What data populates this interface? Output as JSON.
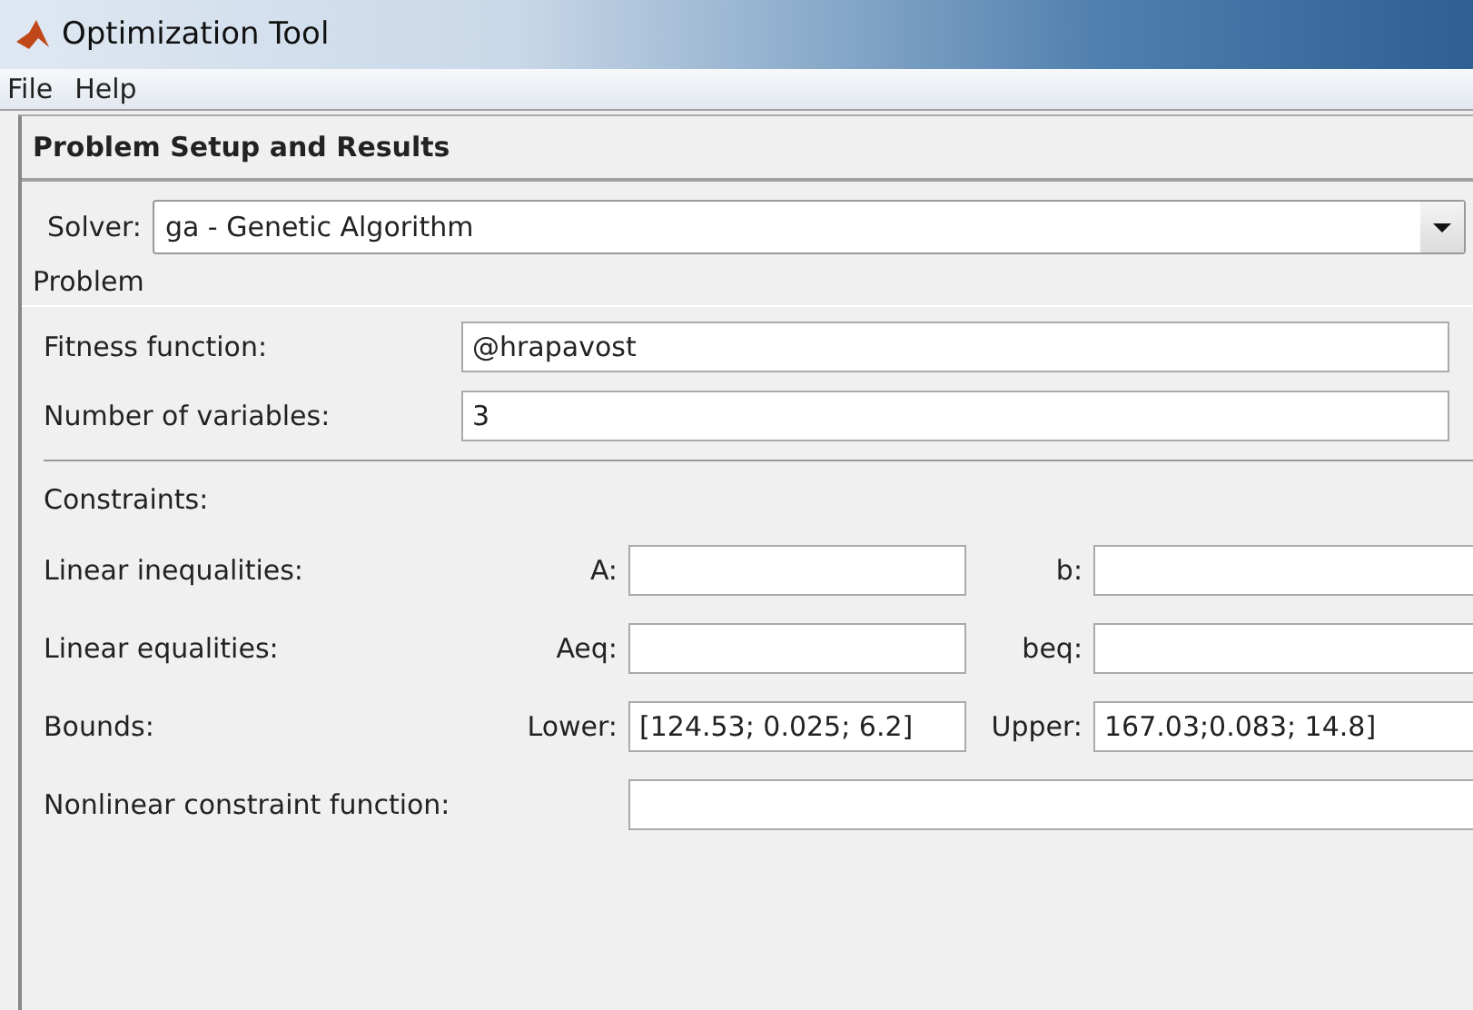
{
  "window": {
    "title": "Optimization Tool"
  },
  "menu": [
    "File",
    "Help"
  ],
  "panel": {
    "title": "Problem Setup and Results"
  },
  "solver": {
    "label": "Solver:",
    "value": "ga - Genetic Algorithm"
  },
  "problem": {
    "title": "Problem",
    "fields": [
      {
        "label": "Fitness function:",
        "value": "@hrapavost"
      },
      {
        "label": "Number of variables:",
        "value": "3"
      }
    ]
  },
  "constraints": {
    "title": "Constraints:",
    "rows": [
      {
        "kind": "pair",
        "label": "Linear inequalities:",
        "left_label": "A:",
        "left_value": "",
        "right_label": "b:",
        "right_value": ""
      },
      {
        "kind": "pair",
        "label": "Linear equalities:",
        "left_label": "Aeq:",
        "left_value": "",
        "right_label": "beq:",
        "right_value": ""
      },
      {
        "kind": "pair",
        "label": "Bounds:",
        "left_label": "Lower:",
        "left_value": "[124.53; 0.025; 6.2]",
        "right_label": "Upper:",
        "right_value": "167.03;0.083; 14.8]"
      },
      {
        "kind": "single",
        "label": "Nonlinear constraint function:",
        "value": ""
      }
    ]
  }
}
